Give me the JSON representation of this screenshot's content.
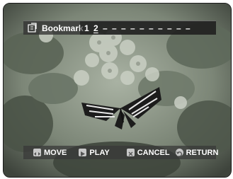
{
  "bookmark": {
    "title": "Bookmark",
    "slots": [
      "1",
      "2",
      "–",
      "–",
      "–",
      "–",
      "–",
      "–",
      "–",
      "–",
      "–",
      "–"
    ],
    "current_slot": 2
  },
  "controls": {
    "move": "MOVE",
    "play": "PLAY",
    "cancel": "CANCEL",
    "return": "RETURN"
  },
  "colors": {
    "bar_bg": "#323232",
    "text": "#ffffff",
    "icon": "#c8c8c8"
  }
}
